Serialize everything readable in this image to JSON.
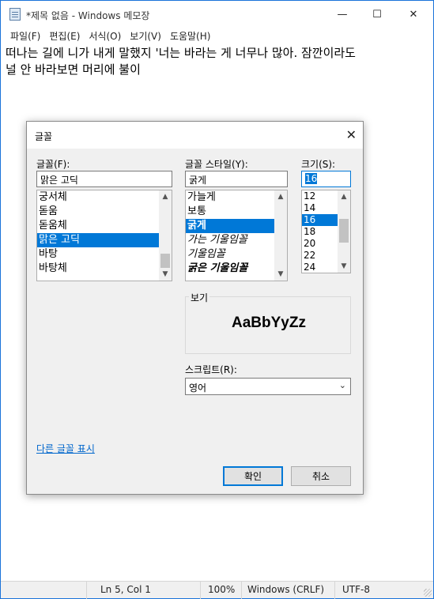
{
  "window": {
    "title": "*제목 없음 - Windows 메모장",
    "minimize_glyph": "—",
    "maximize_glyph": "☐",
    "close_glyph": "✕"
  },
  "menu": [
    "파일(F)",
    "편집(E)",
    "서식(O)",
    "보기(V)",
    "도움말(H)"
  ],
  "editor": {
    "line1": "떠나는 길에 니가 내게 말했지 '너는 바라는 게 너무나 많아. 잠깐이라도",
    "line2": "널 안 바라보면 머리에 불이"
  },
  "status": {
    "position": "Ln 5, Col 1",
    "zoom": "100%",
    "line_ending": "Windows (CRLF)",
    "encoding": "UTF-8"
  },
  "dialog": {
    "title": "글꼴",
    "close_glyph": "✕",
    "font_label": "글꼴(F):",
    "font_value": "맑은 고딕",
    "font_items": [
      "궁서체",
      "돋움",
      "돋움체",
      "맑은 고딕",
      "바탕",
      "바탕체"
    ],
    "font_selected_index": 3,
    "style_label": "글꼴 스타일(Y):",
    "style_value": "굵게",
    "style_items": [
      "가늘게",
      "보통",
      "굵게",
      "가는 기울임꼴",
      "기울임꼴",
      "굵은 기울임꼴"
    ],
    "style_selected_index": 2,
    "size_label": "크기(S):",
    "size_value": "16",
    "size_items": [
      "12",
      "14",
      "16",
      "18",
      "20",
      "22",
      "24"
    ],
    "size_selected_index": 2,
    "preview_label": "보기",
    "preview_text": "AaBbYyZz",
    "script_label": "스크립트(R):",
    "script_value": "영어",
    "more_fonts_link": "다른 글꼴 표시",
    "ok_label": "확인",
    "cancel_label": "취소"
  },
  "colors": {
    "accent": "#0078d7",
    "window_border": "#1a73d9",
    "link": "#0066cc"
  }
}
